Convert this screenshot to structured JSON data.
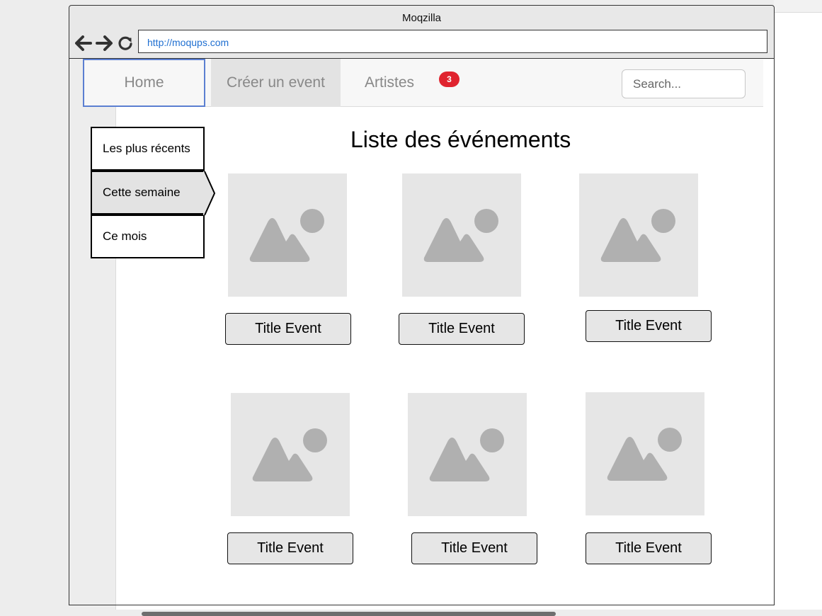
{
  "browser": {
    "title": "Moqzilla",
    "url": "http://moqups.com"
  },
  "navbar": {
    "tabs": [
      {
        "label": "Home"
      },
      {
        "label": "Créer un event"
      },
      {
        "label": "Artistes"
      }
    ],
    "badge_count": "3",
    "search_placeholder": "Search..."
  },
  "sidebar": {
    "items": [
      {
        "label": "Les plus récents"
      },
      {
        "label": "Cette semaine",
        "active": true
      },
      {
        "label": "Ce mois"
      }
    ]
  },
  "main": {
    "heading": "Liste des événements",
    "events": [
      {
        "title": "Title Event",
        "icon": "image-placeholder-icon"
      },
      {
        "title": "Title Event",
        "icon": "image-placeholder-icon"
      },
      {
        "title": "Title Event",
        "icon": "image-placeholder-icon"
      },
      {
        "title": "Title Event",
        "icon": "image-placeholder-icon"
      },
      {
        "title": "Title Event",
        "icon": "image-placeholder-icon"
      },
      {
        "title": "Title Event",
        "icon": "image-placeholder-icon"
      }
    ]
  },
  "colors": {
    "badge": "#e0242f",
    "url_text": "#1f6fd1",
    "active_tab_border": "#5b7fd1",
    "placeholder_bg": "#e6e6e6",
    "placeholder_icon": "#b0b0b0"
  }
}
